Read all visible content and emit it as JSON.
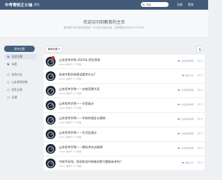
{
  "header": {
    "brand": "中考寄校正士站",
    "home_label": "首页",
    "search_placeholder": "搜索",
    "links": [
      "注册",
      "登录"
    ]
  },
  "banner": {
    "title": "欢迎访问到教育的主页",
    "subtitle": "我们属于为中考考生提供一个讨论交流的平台，您的联系方式0532179781"
  },
  "sidebar": {
    "new_topic_label": "发布主题",
    "items": [
      {
        "label": "全部主题",
        "icon": "list-icon",
        "active": true
      },
      {
        "label": "标签",
        "icon": "tag-icon",
        "active": false
      },
      {
        "label": "综合讨论",
        "icon": "chat-icon",
        "active": false
      },
      {
        "label": "山东招考学院",
        "icon": "school-icon",
        "active": false
      },
      {
        "label": "招生分享",
        "icon": "share-icon",
        "active": false
      },
      {
        "label": "反馈",
        "icon": "feedback-icon",
        "active": false
      }
    ]
  },
  "toolbar": {
    "sort_label": "最新回复"
  },
  "topics": [
    {
      "title": "山东招考学院 2025年 招生简章",
      "meta": "admin 发布于 3 个月前",
      "category": "山东招考学院",
      "replies": "0",
      "pinned": true
    },
    {
      "title": "参加中职学校报读要考什么?",
      "meta": "admin 发布于 3 个月前",
      "category": "招生分享",
      "replies": "0",
      "pinned": false
    },
    {
      "title": "山东招考学院——技能竞赛大奖",
      "meta": "admin 发布于 3 个月前",
      "category": "山东招考学院",
      "replies": "0",
      "pinned": false
    },
    {
      "title": "山东招考学院——学室展示",
      "meta": "admin 发布于 3 个月前",
      "category": "山东招考学院",
      "replies": "0",
      "pinned": false
    },
    {
      "title": "山东招考学院——学校的规定以建筑",
      "meta": "admin 发布于 3 个月前",
      "category": "山东招考学院",
      "replies": "0",
      "pinned": false
    },
    {
      "title": "山东招考学院——生活区展示",
      "meta": "admin 发布于 3 个月前",
      "category": "山东招考学院",
      "replies": "0",
      "pinned": false
    },
    {
      "title": "山东招考学院——教技术实训规律",
      "meta": "admin 发布于 3 个月前",
      "category": "山东招考学院",
      "replies": "0",
      "pinned": false
    },
    {
      "title": "中职不好找，招初职读中职能的更可靠能有考吗？",
      "meta": "admin 发布于 3 个月前",
      "category": "招生分享",
      "replies": "0",
      "pinned": false
    }
  ]
}
